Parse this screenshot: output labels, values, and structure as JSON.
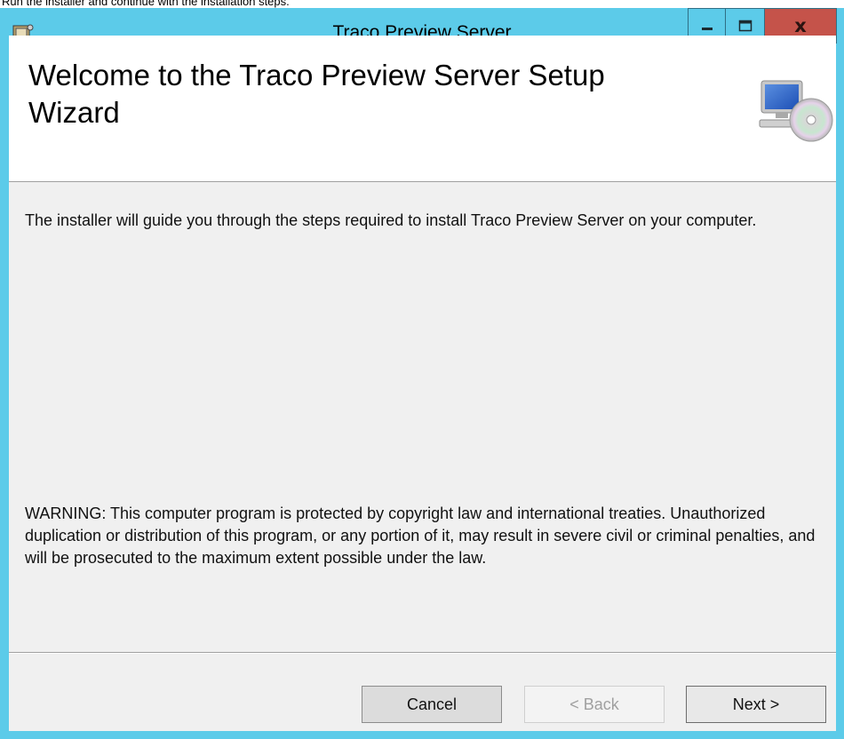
{
  "caption": "Run the installer and continue with the installation steps.",
  "window": {
    "title": "Traco Preview Server",
    "controls": {
      "minimize": "minimize-icon",
      "maximize": "maximize-icon",
      "close_label": "x"
    },
    "accent": "#5ccbe9"
  },
  "banner": {
    "title": "Welcome to the Traco Preview Server Setup Wizard",
    "icon": "computer-cd-icon"
  },
  "content": {
    "intro": "The installer will guide you through the steps required to install Traco Preview Server on your computer.",
    "warning": "WARNING: This computer program is protected by copyright law and international treaties. Unauthorized duplication or distribution of this program, or any portion of it, may result in severe civil or criminal penalties, and will be prosecuted to the maximum extent possible under the law."
  },
  "buttons": {
    "cancel": "Cancel",
    "back": "< Back",
    "next": "Next >"
  }
}
